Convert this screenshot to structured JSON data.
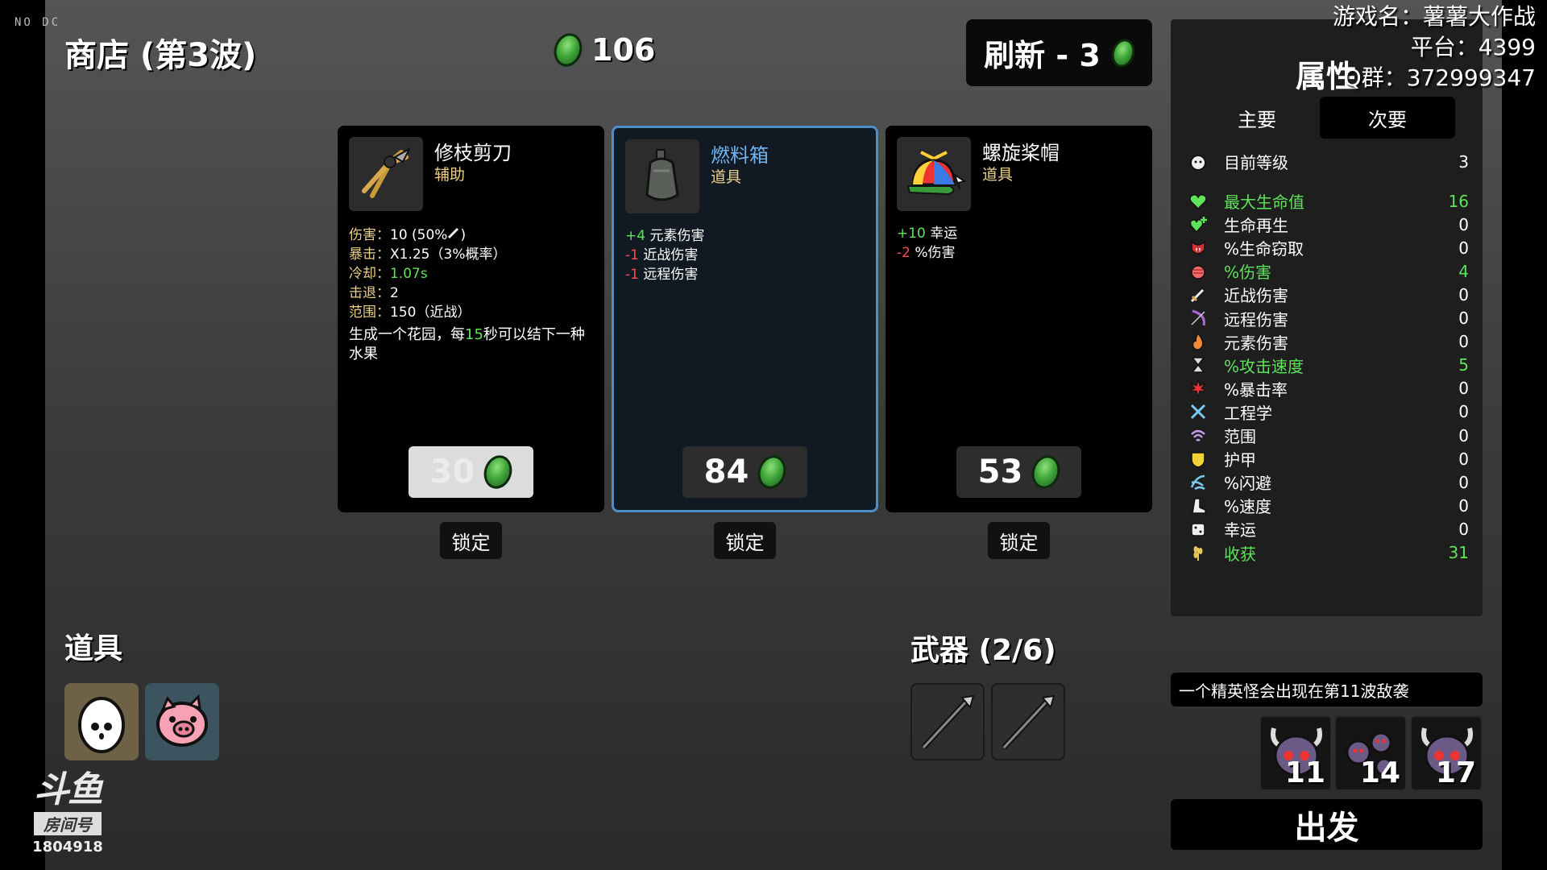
{
  "overlay": {
    "no_dc": "NO DC",
    "game_name": "游戏名：薯薯大作战",
    "platform": "平台：4399",
    "qq_group": "Q群：372999347"
  },
  "header": {
    "title": "商店 (第3波)",
    "materials": "106",
    "refresh_label": "刷新 - 3"
  },
  "shop": {
    "items": [
      {
        "name": "修枝剪刀",
        "type": "辅助",
        "icon": "pruning-shears-icon",
        "stats": {
          "damage_label": "伤害：",
          "damage_value": "10 (50%",
          "damage_suffix": ")",
          "crit_label": "暴击：",
          "crit_value": "X1.25（3%概率）",
          "cooldown_label": "冷却：",
          "cooldown_value": "1.07s",
          "knockback_label": "击退：",
          "knockback_value": "2",
          "range_label": "范围：",
          "range_value": "150（近战）",
          "desc_a": "生成一个花园，每",
          "desc_num": "15",
          "desc_b": "秒可以结下一种水果"
        },
        "price": "30",
        "lock_label": "锁定"
      },
      {
        "name": "燃料箱",
        "type": "道具",
        "icon": "fuel-tank-icon",
        "effects": [
          {
            "value": "+4",
            "label": "元素伤害",
            "color": "#5ee35a"
          },
          {
            "value": "-1",
            "label": "近战伤害",
            "color": "#ff4a4a"
          },
          {
            "value": "-1",
            "label": "远程伤害",
            "color": "#ff4a4a"
          }
        ],
        "price": "84",
        "lock_label": "锁定"
      },
      {
        "name": "螺旋桨帽",
        "type": "道具",
        "icon": "propeller-hat-icon",
        "effects": [
          {
            "value": "+10",
            "label": "幸运",
            "color": "#5ee35a"
          },
          {
            "value": "-2",
            "label": "%伤害",
            "color": "#ff4a4a"
          }
        ],
        "price": "53",
        "lock_label": "锁定"
      }
    ]
  },
  "inventory": {
    "items_title": "道具",
    "items": [
      {
        "icon": "egg-icon"
      },
      {
        "icon": "piggy-bank-icon"
      }
    ],
    "weapons_title": "武器 (2/6)",
    "weapons": [
      {
        "icon": "spear-icon"
      },
      {
        "icon": "spear-icon"
      }
    ]
  },
  "stats_panel": {
    "title": "属性",
    "tabs": [
      "主要",
      "次要"
    ],
    "active_tab": 1,
    "level_label": "目前等级",
    "level_value": "3",
    "rows": [
      {
        "label": "最大生命值",
        "value": "16",
        "icon": "heart-icon",
        "highlight": true
      },
      {
        "label": "生命再生",
        "value": "0",
        "icon": "regen-heart-icon",
        "highlight": false
      },
      {
        "label": "%生命窃取",
        "value": "0",
        "icon": "vampire-icon",
        "highlight": false
      },
      {
        "label": "%伤害",
        "value": "4",
        "icon": "fist-icon",
        "highlight": true
      },
      {
        "label": "近战伤害",
        "value": "0",
        "icon": "sword-icon",
        "highlight": false
      },
      {
        "label": "远程伤害",
        "value": "0",
        "icon": "bow-icon",
        "highlight": false
      },
      {
        "label": "元素伤害",
        "value": "0",
        "icon": "flame-icon",
        "highlight": false
      },
      {
        "label": "%攻击速度",
        "value": "5",
        "icon": "hourglass-icon",
        "highlight": true
      },
      {
        "label": "%暴击率",
        "value": "0",
        "icon": "crit-burst-icon",
        "highlight": false
      },
      {
        "label": "工程学",
        "value": "0",
        "icon": "wrench-icon",
        "highlight": false
      },
      {
        "label": "范围",
        "value": "0",
        "icon": "range-waves-icon",
        "highlight": false
      },
      {
        "label": "护甲",
        "value": "0",
        "icon": "shield-icon",
        "highlight": false
      },
      {
        "label": "%闪避",
        "value": "0",
        "icon": "dodge-icon",
        "highlight": false
      },
      {
        "label": "%速度",
        "value": "0",
        "icon": "boot-icon",
        "highlight": false
      },
      {
        "label": "幸运",
        "value": "0",
        "icon": "dice-icon",
        "highlight": false
      },
      {
        "label": "收获",
        "value": "31",
        "icon": "wheat-icon",
        "highlight": true
      }
    ]
  },
  "waves": {
    "elite_message": "一个精英怪会出现在第11波敌袭",
    "upcoming": [
      {
        "wave": "11",
        "icon": "horned-skull-icon"
      },
      {
        "wave": "14",
        "icon": "swarm-icon"
      },
      {
        "wave": "17",
        "icon": "horned-skull-icon"
      }
    ],
    "go_label": "出发"
  },
  "watermark": {
    "logo": "斗鱼",
    "room_label": "房间号",
    "room_id": "1804918"
  },
  "colors": {
    "positive": "#5ee35a",
    "negative": "#ff4a4a",
    "item_type": "#ecd08a",
    "selected_border": "#4b8ec9",
    "item_name_highlight": "#6fb4f0"
  }
}
